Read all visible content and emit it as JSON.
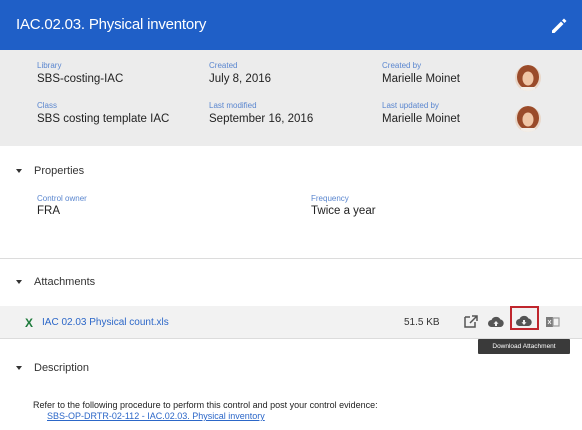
{
  "header": {
    "title": "IAC.02.03. Physical inventory"
  },
  "meta": {
    "library_label": "Library",
    "library_value": "SBS-costing-IAC",
    "created_label": "Created",
    "created_value": "July 8, 2016",
    "created_by_label": "Created by",
    "created_by_value": "Marielle Moinet",
    "class_label": "Class",
    "class_value": "SBS costing template IAC",
    "modified_label": "Last modified",
    "modified_value": "September 16, 2016",
    "updated_by_label": "Last updated by",
    "updated_by_value": "Marielle Moinet"
  },
  "properties": {
    "heading": "Properties",
    "control_owner_label": "Control owner",
    "control_owner_value": "FRA",
    "frequency_label": "Frequency",
    "frequency_value": "Twice a year"
  },
  "attachments": {
    "heading": "Attachments",
    "file_icon": "X",
    "file_name": "IAC 02.03 Physical count.xls",
    "file_size": "51.5 KB",
    "tooltip": "Download Attachment"
  },
  "description": {
    "heading": "Description",
    "text": "Refer to the following procedure to perform this control and post your control evidence:",
    "link": "SBS-OP-DRTR-02-112 - IAC.02.03. Physical inventory"
  },
  "colors": {
    "header": "#1f5fc7",
    "meta_bg": "#ececec",
    "label": "#5a86cf",
    "link": "#2c67c8",
    "excel": "#1d7a3b",
    "highlight": "#c0262d"
  },
  "icons": [
    "pencil-icon",
    "avatar",
    "caret-down-icon",
    "excel-icon",
    "open-external-icon",
    "cloud-upload-icon",
    "cloud-download-icon",
    "office-icon"
  ]
}
